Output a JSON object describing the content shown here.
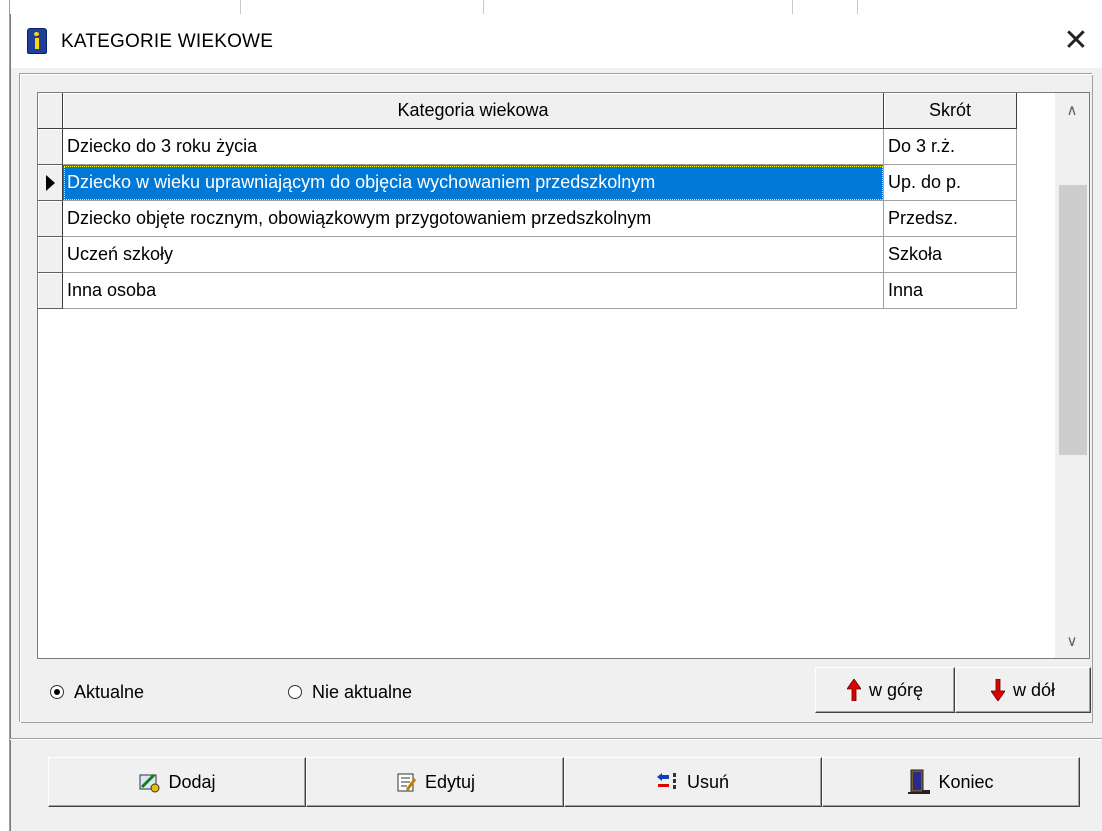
{
  "window": {
    "title": "KATEGORIE WIEKOWE",
    "close_glyph": "✕"
  },
  "grid": {
    "columns": [
      "Kategoria wiekowa",
      "Skrót"
    ],
    "rows": [
      {
        "name": "Dziecko do 3 roku życia",
        "short": "Do 3 r.ż.",
        "selected": false
      },
      {
        "name": "Dziecko w wieku uprawniającym do objęcia wychowaniem przedszkolnym",
        "short": "Up. do p.",
        "selected": true
      },
      {
        "name": "Dziecko objęte rocznym, obowiązkowym przygotowaniem przedszkolnym",
        "short": "Przedsz.",
        "selected": false
      },
      {
        "name": "Uczeń szkoły",
        "short": "Szkoła",
        "selected": false
      },
      {
        "name": "Inna osoba",
        "short": "Inna",
        "selected": false
      }
    ],
    "scroll_up_glyph": "∧",
    "scroll_down_glyph": "∨"
  },
  "filter": {
    "option_current": "Aktualne",
    "option_not_current": "Nie aktualne",
    "selected": "Aktualne"
  },
  "order": {
    "up_label": "w górę",
    "down_label": "w dół"
  },
  "actions": {
    "add": "Dodaj",
    "edit": "Edytuj",
    "delete": "Usuń",
    "close": "Koniec"
  },
  "colors": {
    "selection": "#0078d7",
    "arrow_red": "#e00000",
    "title_icon": "#1e3f9a"
  },
  "icons": {
    "title": "info-book-icon",
    "up": "red-arrow-up-icon",
    "down": "red-arrow-down-icon",
    "add": "add-record-icon",
    "edit": "edit-record-icon",
    "delete": "delete-record-icon",
    "close": "exit-door-icon"
  }
}
